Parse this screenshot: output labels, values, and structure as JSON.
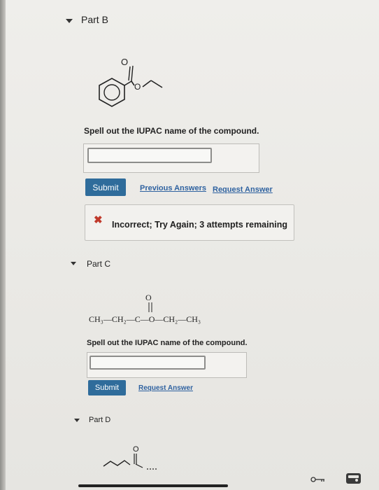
{
  "partB": {
    "title": "Part B",
    "molecule_label": "O",
    "molecule_ester_o": "O",
    "question": "Spell out the IUPAC name of the compound.",
    "answer_value": "",
    "submit_label": "Submit",
    "previous_answers_label": "Previous Answers",
    "request_answer_label": "Request Answer",
    "feedback_text": "Incorrect; Try Again; 3 attempts remaining"
  },
  "partC": {
    "title": "Part C",
    "formula_o_top": "O",
    "formula_text": "CH₃—CH₂—C—O—CH₂—CH₃",
    "question": "Spell out the IUPAC name of the compound.",
    "answer_value": "",
    "submit_label": "Submit",
    "request_answer_label": "Request Answer"
  },
  "partD": {
    "title": "Part D",
    "molecule_label": "O"
  },
  "colors": {
    "button": "#2f6c9b",
    "link": "#2f62a0",
    "error": "#c0392b"
  }
}
